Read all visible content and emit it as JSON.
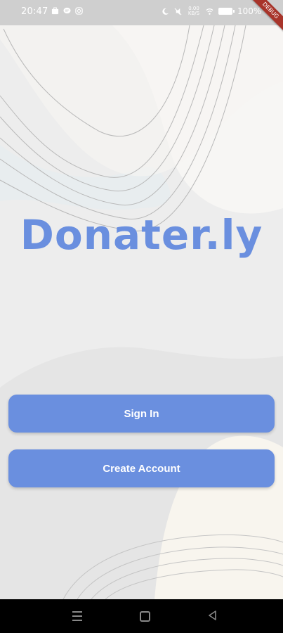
{
  "status_bar": {
    "time": "20:47",
    "net_speed": "0.00 KB/S",
    "battery": "100%"
  },
  "ribbon": {
    "label": "DEBUG"
  },
  "app": {
    "title": "Donater.ly"
  },
  "buttons": {
    "sign_in": "Sign In",
    "create_account": "Create Account"
  },
  "colors": {
    "accent": "#6a8fdf",
    "background": "#ededed",
    "navbar": "#000000"
  },
  "icons": [
    "notification-icon",
    "chat-icon",
    "instagram-icon",
    "moon-icon",
    "mute-icon",
    "wifi-icon",
    "battery-icon",
    "menu-icon",
    "home-icon",
    "back-icon"
  ]
}
